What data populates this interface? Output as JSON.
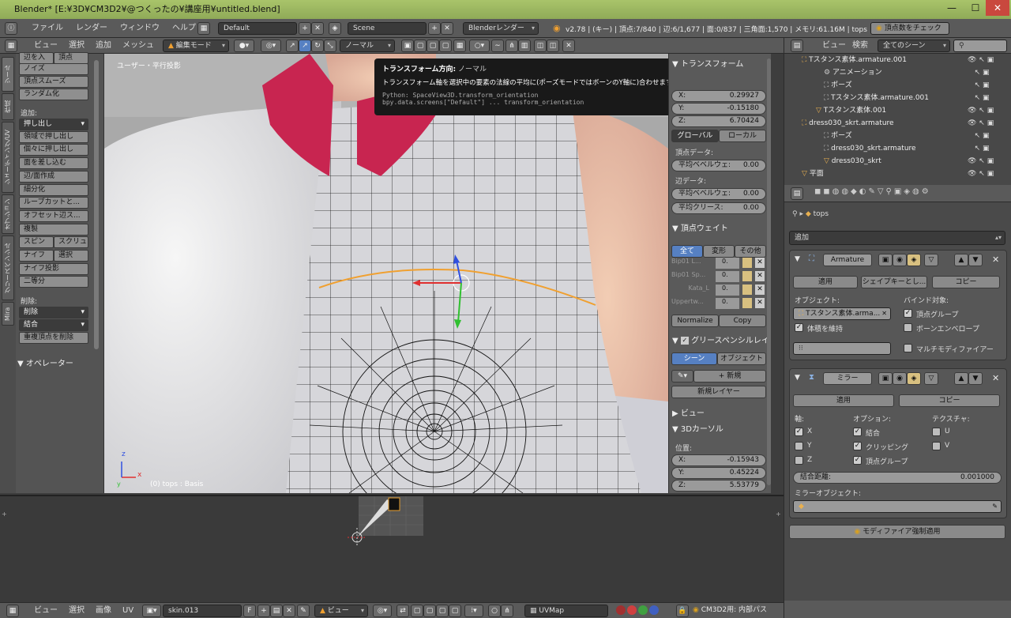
{
  "window": {
    "title": "Blender* [E:¥3D¥CM3D2¥@つくったの¥講座用¥untitled.blend]",
    "btn_min": "—",
    "btn_max": "☐",
    "btn_close": "✕"
  },
  "info_header": {
    "menus": [
      "ファイル",
      "レンダー",
      "ウィンドウ",
      "ヘルプ"
    ],
    "layout": "Default",
    "scene": "Scene",
    "renderer": "Blenderレンダー",
    "stats": "v2.78 | (キー) | 頂点:7/840 | 辺:6/1,677 | 面:0/837 | 三角面:1,570 | メモリ:61.16M | tops",
    "check_button": "頂点数をチェック"
  },
  "view_header": {
    "menus": [
      "ビュー",
      "選択",
      "追加",
      "メッシュ"
    ],
    "mode": "編集モード",
    "orientation": "ノーマル"
  },
  "toolshelf_tabs": [
    "ツール",
    "作成",
    "シェーディング/UV",
    "オプション",
    "グリースペンシル",
    "Mira"
  ],
  "toolshelf": {
    "top_partial_1": "辺を入",
    "top_partial_2": "頂点",
    "items_top": [
      "ノイズ",
      "頂点スムーズ",
      "ランダム化"
    ],
    "add_label": "追加:",
    "extrude": "押し出し",
    "items_add": [
      "領域で押し出し",
      "個々に押し出し",
      "面を差し込む",
      "辺/面作成",
      "細分化",
      "ループカットと...",
      "オフセット辺ス...",
      "複製"
    ],
    "spin": "スピン",
    "screw": "スクリュ",
    "knife": "ナイフ",
    "select": "選択",
    "knife_project": "ナイフ投影",
    "bisect": "二等分",
    "delete_label": "削除:",
    "delete": "削除",
    "merge": "結合",
    "remove_doubles": "重複頂点を削除",
    "operator": "▼ オペレーター"
  },
  "viewport": {
    "view_label": "ユーザー・平行投影",
    "object_label": "(0) tops : Basis",
    "axis_x": "x",
    "axis_y": "y",
    "axis_z": "z"
  },
  "tooltip": {
    "title": "トランスフォーム方向:",
    "value": "ノーマル",
    "desc": "トランスフォーム軸を選択中の要素の法線の平均に(ポーズモードではボーンのY軸に)合わせます",
    "python1": "Python: SpaceView3D.transform_orientation",
    "python2": "bpy.data.screens[\"Default\"] ... transform_orientation"
  },
  "npanel": {
    "transform_title": "▼ トランスフォーム",
    "x_label": "X:",
    "x": "0.29927",
    "y_label": "Y:",
    "y": "-0.15180",
    "z_label": "Z:",
    "z": "6.70424",
    "global": "グローバル",
    "local": "ローカル",
    "vertex_data": "頂点データ:",
    "bevel_weight_label": "平均ベベルウェ:",
    "bevel_weight": "0.00",
    "edge_data": "辺データ:",
    "edge_bevel_label": "平均ベベルウェ:",
    "edge_bevel": "0.00",
    "crease_label": "平均クリース:",
    "crease": "0.00",
    "vertex_weights_title": "▼ 頂点ウェイト",
    "tab_all": "全て",
    "tab_deform": "変形",
    "tab_other": "その他",
    "weights": [
      {
        "name": "Bip01 L...",
        "value": "0."
      },
      {
        "name": "Bip01 Sp...",
        "value": "0."
      },
      {
        "name": "Kata_L",
        "value": "0."
      },
      {
        "name": "Uppertw...",
        "value": "0."
      }
    ],
    "normalize": "Normalize",
    "copy": "Copy",
    "grease_title": "グリースペンシルレイ",
    "scene": "シーン",
    "object": "オブジェクト",
    "new": "新規",
    "new_layer": "新規レイヤー",
    "view_title": "▶ ビュー",
    "cursor_title": "▼ 3Dカーソル",
    "position": "位置:",
    "cx_label": "X:",
    "cx": "-0.15943",
    "cy_label": "Y:",
    "cy": "0.45224",
    "cz_label": "Z:",
    "cz": "5.53779"
  },
  "outliner": {
    "menus": [
      "ビュー",
      "検索"
    ],
    "scenes": "全てのシーン",
    "rows": [
      "Tスタンス素体.armature.001",
      "アニメーション",
      "ポーズ",
      "Tスタンス素体.armature.001",
      "Tスタンス素体.001",
      "dress030_skrt.armature",
      "ポーズ",
      "dress030_skrt.armature",
      "dress030_skrt",
      "平面"
    ]
  },
  "properties": {
    "breadcrumb": "tops",
    "add_modifier": "追加",
    "armature": {
      "name": "Armature",
      "apply": "適用",
      "shape": "シェイプキーとし...",
      "copy": "コピー",
      "object_label": "オブジェクト:",
      "object": "Tスタンス素体.arma...",
      "bind_label": "バインド対象:",
      "preserve_volume": "体積を維持",
      "vertex_groups": "頂点グループ",
      "bone_envelopes": "ボーンエンベロープ",
      "multi_modifier": "マルチモディファイアー"
    },
    "mirror": {
      "name": "ミラー",
      "apply": "適用",
      "copy": "コピー",
      "axis_label": "軸:",
      "options_label": "オプション:",
      "texture_label": "テクスチャ:",
      "x": "X",
      "y": "Y",
      "z": "Z",
      "merge": "結合",
      "clipping": "クリッピング",
      "vertex_groups": "頂点グループ",
      "u": "U",
      "v": "V",
      "merge_distance_label": "結合距離:",
      "merge_distance": "0.001000",
      "mirror_object": "ミラーオブジェクト:"
    },
    "force_apply": "モディファイア強制適用",
    "footer": "CM3D2用: 内部パス"
  },
  "uv_header": {
    "menus": [
      "ビュー",
      "選択",
      "画像",
      "UV"
    ],
    "image": "skin.013",
    "fake": "F",
    "view": "ビュー",
    "uvmap": "UVMap"
  }
}
